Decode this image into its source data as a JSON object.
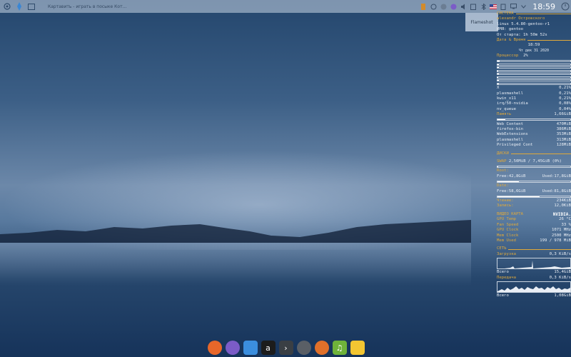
{
  "taskbar": {
    "task_title": "Картавить - играть в посыке Кот..."
  },
  "tray": {
    "clock": "18:59"
  },
  "flameshot": {
    "label": "Flameshot"
  },
  "conky": {
    "system": {
      "title": "СИСТЕМА",
      "user": "alexandr Островского",
      "kernel": "linux 5.4.80-gentoo-r1",
      "host": "ИМЯ: gentoo",
      "uptime": "От старта: 1h 50m 52s"
    },
    "datetime": {
      "title": "Дата & Время",
      "time": "18:59",
      "date": "Чт дек 31 2020"
    },
    "cpu": {
      "label": "Процессор",
      "value": "2%",
      "core_fill": [
        0.03,
        0.02,
        0.02,
        0.01,
        0.02,
        0.01,
        0.02,
        0.02
      ]
    },
    "cpu_processes": [
      {
        "name": "X",
        "value": "0,21%"
      },
      {
        "name": "plasmashell",
        "value": "0,21%"
      },
      {
        "name": "kwin_x11",
        "value": "0,21%"
      },
      {
        "name": "irq/50-nvidia",
        "value": "0,08%"
      },
      {
        "name": "nv_queue",
        "value": "0,04%"
      }
    ],
    "memory": {
      "label": "Память",
      "value": "1,66GiB",
      "fill": 0.11
    },
    "mem_processes": [
      {
        "name": "Web Content",
        "value": "470MiB"
      },
      {
        "name": "firefox-bin",
        "value": "386MiB"
      },
      {
        "name": "WebExtensions",
        "value": "353MiB"
      },
      {
        "name": "plasmashell",
        "value": "313MiB"
      },
      {
        "name": "Privileged Cont",
        "value": "128MiB"
      }
    ],
    "disks": {
      "title": "ДИСКИ",
      "swap_label": "SWAP",
      "swap_value": "2,50MiB / 7,45GiB (0%)",
      "root_label": "Root:",
      "root_free": "Free:42,8GiB",
      "root_used": "Used:17,8GiB",
      "root_fill": 0.29,
      "date_label": "Date:",
      "date_free": "Free:58,6GiB",
      "date_used": "Used:81,8GiB",
      "date_fill": 0.58,
      "read_label": "Чтение:",
      "read_value": "234KiB",
      "write_label": "Запись:",
      "write_value": "12,0KiB"
    },
    "gpu": {
      "title": "ВИДЕО КАРТА",
      "brand": "NVIDIA.",
      "rows": [
        {
          "name": "GPU Temp",
          "value": "26 °C"
        },
        {
          "name": "Fan Speed",
          "value": "33 %"
        },
        {
          "name": "GPU Clock",
          "value": "1071 MHz"
        },
        {
          "name": "Mem Clock",
          "value": "2500 MHz"
        },
        {
          "name": "Mem Used",
          "value": "199 / 978 MiB"
        }
      ]
    },
    "network": {
      "title": "СЕТЬ",
      "down_label": "Загрузка",
      "down_value": "0,3 KiB/s",
      "down_total_label": "Всего",
      "down_total_value": "15,4GiB",
      "up_label": "Передача",
      "up_value": "0,3 KiB/s",
      "up_total_label": "Всего",
      "up_total_value": "1,08GiB"
    }
  },
  "dock": [
    {
      "name": "firefox",
      "glyph": "",
      "color": "#e8672a"
    },
    {
      "name": "viber",
      "glyph": "",
      "color": "#7b5cc7"
    },
    {
      "name": "files",
      "glyph": "",
      "color": "#3b8ede"
    },
    {
      "name": "amarok",
      "glyph": "a",
      "color": "#1c1c1c"
    },
    {
      "name": "terminal",
      "glyph": "›",
      "color": "#3a3f44"
    },
    {
      "name": "disk",
      "glyph": "",
      "color": "#5a5f66"
    },
    {
      "name": "camera",
      "glyph": "",
      "color": "#e0702a"
    },
    {
      "name": "music",
      "glyph": "♫",
      "color": "#6fb33a"
    },
    {
      "name": "notes",
      "glyph": "",
      "color": "#f3c632"
    }
  ],
  "colors": {
    "accent": "#e0a93a"
  }
}
